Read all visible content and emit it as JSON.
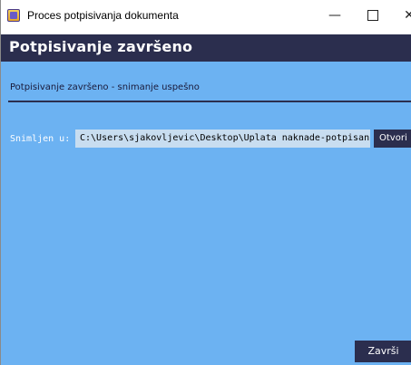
{
  "window": {
    "title": "Proces potpisivanja dokumenta",
    "minimize_glyph": "—",
    "close_glyph": "✕",
    "app_icon": "document-sign-icon"
  },
  "header": {
    "title": "Potpisivanje završeno"
  },
  "status": {
    "text": "Potpisivanje završeno - snimanje uspešno"
  },
  "saved": {
    "label": "Snimljen u:",
    "path": "C:\\Users\\sjakovljevic\\Desktop\\Uplata naknade-potpisan.pdf",
    "open_label": "Otvori"
  },
  "footer": {
    "finish_label": "Završi"
  },
  "colors": {
    "background": "#6cb2f2",
    "header": "#2b2e4e",
    "path_field": "#c8ddf0"
  }
}
